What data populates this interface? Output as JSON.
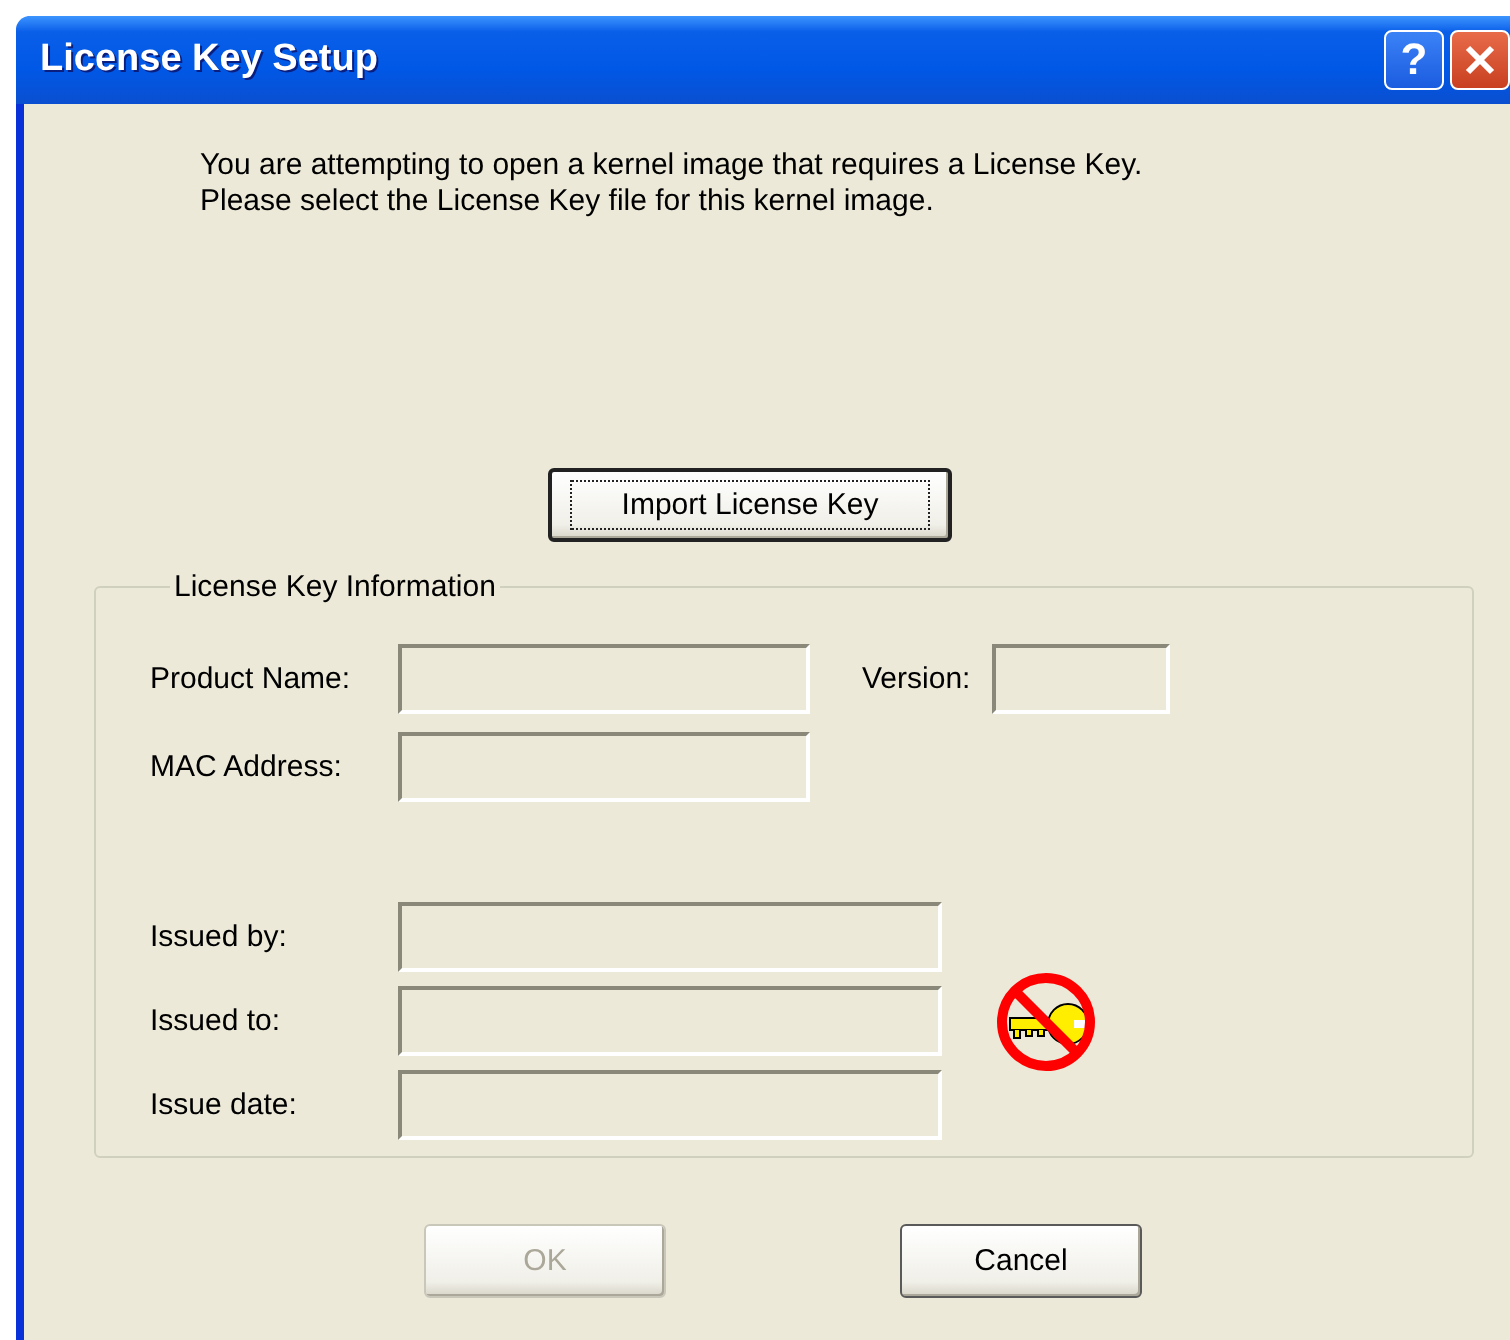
{
  "window": {
    "title": "License Key Setup",
    "help_button": "?"
  },
  "message_lines": [
    "You are attempting to open a kernel image that requires a License Key.",
    "Please select the License Key file for this kernel image."
  ],
  "import_button": {
    "label": "Import License Key",
    "focused": true,
    "disabled": false
  },
  "group": {
    "title": "License Key Information",
    "product_fields": [
      {
        "label": "Product Name:",
        "disabled": true
      },
      {
        "label": "MAC Address:",
        "disabled": true
      }
    ],
    "version_field": {
      "label": "Version:",
      "disabled": true
    },
    "issue_fields": [
      {
        "label": "Issued by:",
        "disabled": true
      },
      {
        "label": "Issued to:",
        "disabled": true
      },
      {
        "label": "Issue date:",
        "disabled": true
      }
    ]
  },
  "buttons": [
    {
      "label": "OK",
      "disabled": true,
      "focused": false
    },
    {
      "label": "Cancel",
      "disabled": false,
      "focused": false
    }
  ]
}
